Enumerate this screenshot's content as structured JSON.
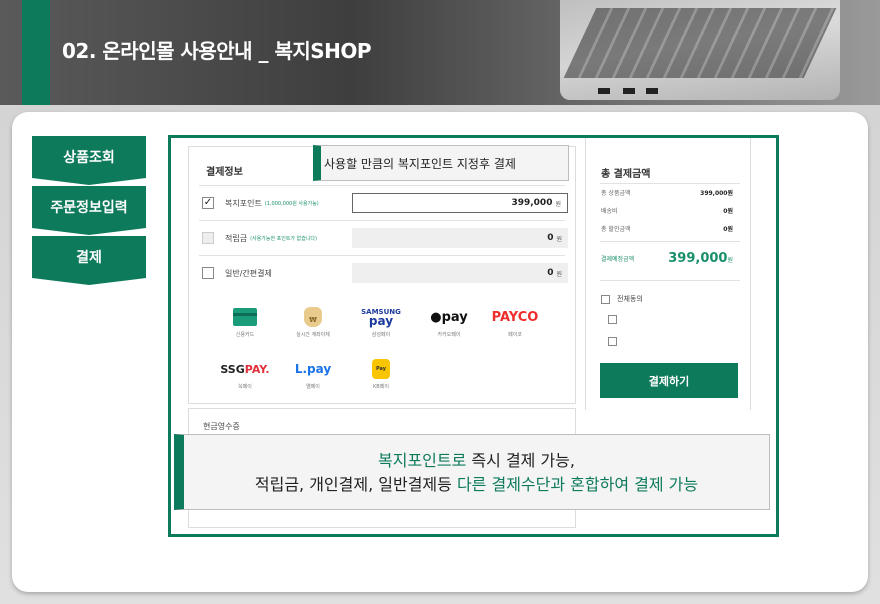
{
  "header": {
    "title": "02. 온라인몰 사용안내 _ 복지SHOP",
    "accent": "#0e7a5c"
  },
  "steps": [
    {
      "label": "상품조회"
    },
    {
      "label": "주문정보입력"
    },
    {
      "label": "결제"
    }
  ],
  "payment": {
    "title": "결제정보",
    "rows": [
      {
        "label": "복지포인트",
        "sub": "(1,000,000원 사용가능)",
        "value": "399,000",
        "unit": "원",
        "checked": true
      },
      {
        "label": "적립금",
        "sub": "(사용가능한 포인트가 없습니다)",
        "value": "0",
        "unit": "원",
        "checked": false
      },
      {
        "label": "일반/간편결제",
        "sub": "",
        "value": "0",
        "unit": "원",
        "checked": false
      }
    ],
    "methods": [
      {
        "name": "신용카드",
        "icon": "credit-card-icon"
      },
      {
        "name": "실시간 계좌이체",
        "icon": "money-bag-icon"
      },
      {
        "name": "삼성페이",
        "brand_top": "SAMSUNG",
        "brand_bottom": "pay"
      },
      {
        "name": "카카오페이",
        "brand": "●pay"
      },
      {
        "name": "페이코",
        "brand": "PAYCO"
      },
      {
        "name": "쓱페이",
        "brand_a": "SSG",
        "brand_b": "PAY."
      },
      {
        "name": "엘페이",
        "brand": "L.pay"
      },
      {
        "name": "KB페이",
        "icon": "kb-pay-icon",
        "brand": "Pay"
      }
    ],
    "cash_receipt_title": "현금영수증"
  },
  "summary": {
    "title": "총 결제금액",
    "lines": [
      {
        "label": "총 상품금액",
        "value": "399,000원"
      },
      {
        "label": "배송비",
        "value": "0원"
      },
      {
        "label": "총 할인금액",
        "value": "0원"
      }
    ],
    "total_label": "결제예정금액",
    "total_value": "399,000",
    "total_unit": "원",
    "agree_all": "전체동의",
    "pay_button": "결제하기"
  },
  "callouts": {
    "top": "사용할 만큼의 복지포인트 지정후 결제",
    "bottom_line1_a": "복지포인트로",
    "bottom_line1_b": " 즉시 결제 가능,",
    "bottom_line2_a": "적립금, 개인결제, 일반결제등 ",
    "bottom_line2_b": "다른 결제수단과 혼합하여 결제 가능"
  }
}
